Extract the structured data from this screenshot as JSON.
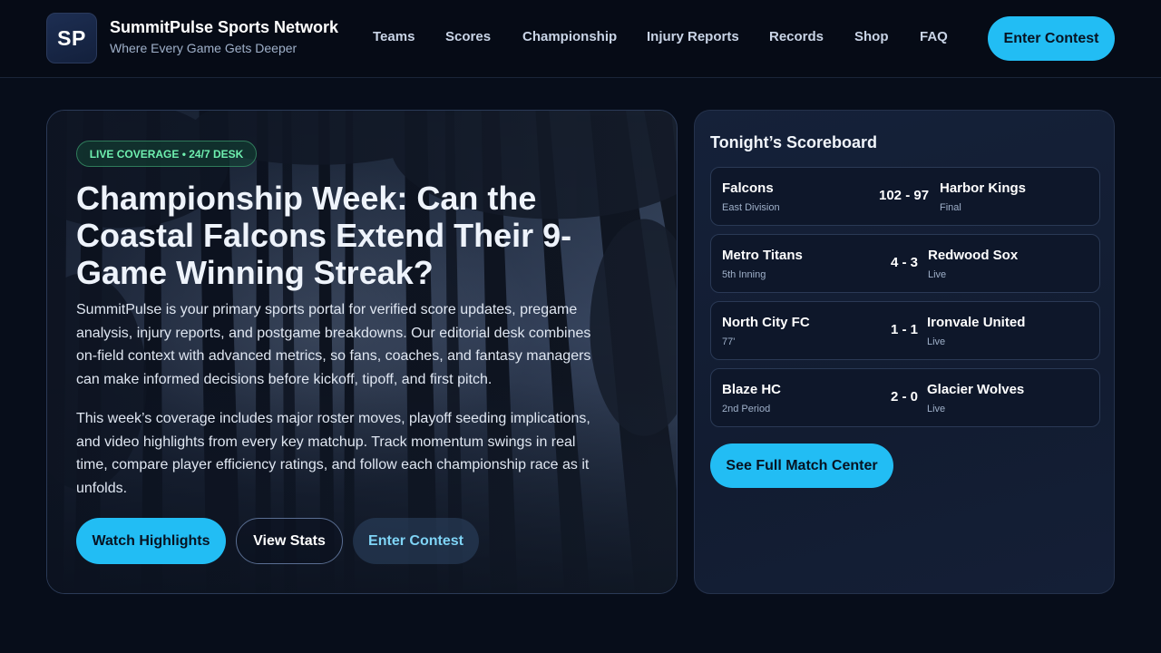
{
  "brand": {
    "logo_initials": "SP",
    "name": "SummitPulse Sports Network",
    "tagline": "Where Every Game Gets Deeper"
  },
  "nav": {
    "items": [
      {
        "label": "Teams"
      },
      {
        "label": "Scores"
      },
      {
        "label": "Championship"
      },
      {
        "label": "Injury Reports"
      },
      {
        "label": "Records"
      },
      {
        "label": "Shop"
      },
      {
        "label": "FAQ"
      }
    ],
    "cta_label": "Enter Contest"
  },
  "hero": {
    "badge": "LIVE COVERAGE • 24/7 DESK",
    "title": "Championship Week: Can the Coastal Falcons Extend Their 9-Game Winning Streak?",
    "paragraph_1": "SummitPulse is your primary sports portal for verified score updates, pregame analysis, injury reports, and postgame breakdowns. Our editorial desk combines on-field context with advanced metrics, so fans, coaches, and fantasy managers can make informed decisions before kickoff, tipoff, and first pitch.",
    "paragraph_2": "This week’s coverage includes major roster moves, playoff seeding implications, and video highlights from every key matchup. Track momentum swings in real time, compare player efficiency ratings, and follow each championship race as it unfolds.",
    "buttons": {
      "primary": "Watch Highlights",
      "secondary": "View Stats",
      "tertiary": "Enter Contest"
    }
  },
  "scoreboard": {
    "title": "Tonight’s Scoreboard",
    "matches": [
      {
        "team_a": "Falcons",
        "meta_a": "East Division",
        "score": "102 - 97",
        "team_b": "Harbor Kings",
        "meta_b": "Final"
      },
      {
        "team_a": "Metro Titans",
        "meta_a": "5th Inning",
        "score": "4 - 3",
        "team_b": "Redwood Sox",
        "meta_b": "Live"
      },
      {
        "team_a": "North City FC",
        "meta_a": "77'",
        "score": "1 - 1",
        "team_b": "Ironvale United",
        "meta_b": "Live"
      },
      {
        "team_a": "Blaze HC",
        "meta_a": "2nd Period",
        "score": "2 - 0",
        "team_b": "Glacier Wolves",
        "meta_b": "Live"
      }
    ],
    "cta_label": "See Full Match Center"
  },
  "colors": {
    "accent": "#22bdf4",
    "background": "#070d1a",
    "badge_text": "#6ff0b0"
  }
}
